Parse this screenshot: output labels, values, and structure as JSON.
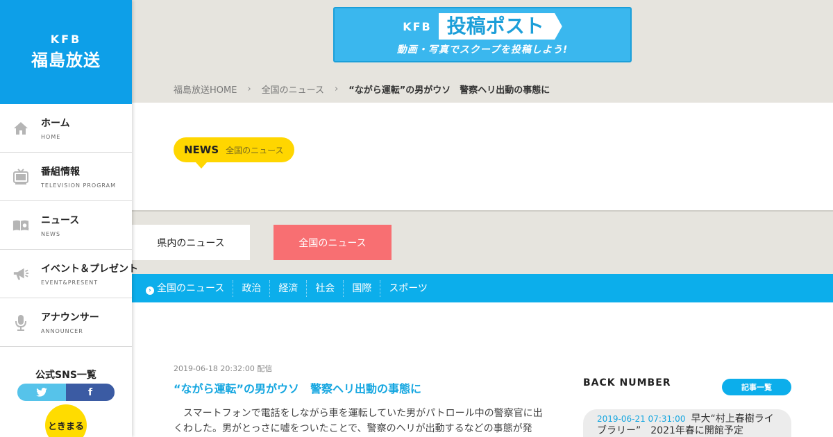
{
  "sidebar": {
    "logo": {
      "kfb": "KFB",
      "name": "福島放送"
    },
    "items": [
      {
        "label": "ホーム",
        "sub": "HOME",
        "icon": "home-icon"
      },
      {
        "label": "番組情報",
        "sub": "TELEVISION PROGRAM",
        "icon": "tv-icon"
      },
      {
        "label": "ニュース",
        "sub": "NEWS",
        "icon": "news-icon"
      },
      {
        "label": "イベント＆プレゼント",
        "sub": "EVENT&PRESENT",
        "icon": "megaphone-icon"
      },
      {
        "label": "アナウンサー",
        "sub": "ANNOUNCER",
        "icon": "microphone-icon"
      }
    ],
    "sns_title": "公式SNS一覧",
    "facebook": "f",
    "tokimaru": "ときまる"
  },
  "banner": {
    "kfb": "KFB",
    "title": "投稿ポスト",
    "sub": "動画・写真でスクープを投稿しよう!"
  },
  "breadcrumb": {
    "home": "福島放送HOME",
    "section": "全国のニュース",
    "current": "“ながら運転”の男がウソ　警察ヘリ出動の事態に",
    "sep": "›"
  },
  "news_tag": {
    "label": "NEWS",
    "sub": "全国のニュース"
  },
  "tabs": {
    "local": "県内のニュース",
    "national": "全国のニュース"
  },
  "categories": [
    "全国のニュース",
    "政治",
    "経済",
    "社会",
    "国際",
    "スポーツ"
  ],
  "article": {
    "date": "2019-06-18 20:32:00 配信",
    "title": "“ながら運転”の男がウソ　警察ヘリ出動の事態に",
    "body": "　スマートフォンで電話をしながら車を運転していた男がパトロール中の警察官に出くわした。男がとっさに嘘をついたことで、警察のヘリが出動するなどの事態が発生。男はスマートフォンを使用しながら運転していたとして摘発された。"
  },
  "back_number": {
    "title": "BACK NUMBER",
    "list_button": "記事一覧",
    "items": [
      {
        "date": "2019-06-21 07:31:00",
        "title": "早大“村上春樹ライブラリー”　2021年春に開館予定"
      }
    ]
  },
  "colors": {
    "brand_blue": "#0d9fe8",
    "tab_red": "#f86f72",
    "news_yellow": "#ffd600",
    "category_bar": "#0caeeb"
  }
}
